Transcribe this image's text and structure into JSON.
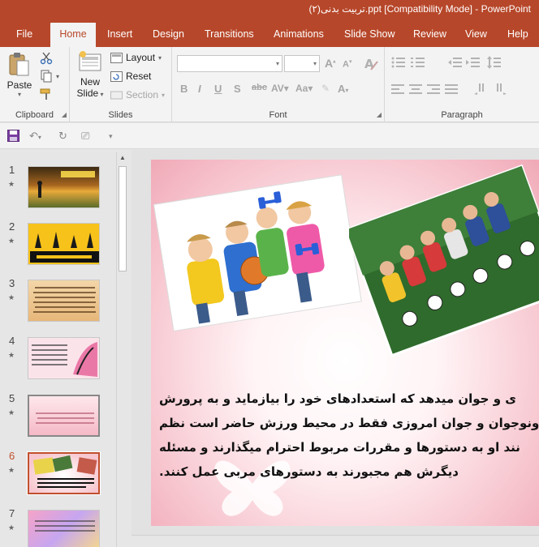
{
  "window": {
    "title": "(۲)تربیت بدنی.ppt [Compatibility Mode]  -  PowerPoint"
  },
  "ribbon_tabs": [
    {
      "label": "File"
    },
    {
      "label": "Home"
    },
    {
      "label": "Insert"
    },
    {
      "label": "Design"
    },
    {
      "label": "Transitions"
    },
    {
      "label": "Animations"
    },
    {
      "label": "Slide Show"
    },
    {
      "label": "Review"
    },
    {
      "label": "View"
    },
    {
      "label": "Help"
    }
  ],
  "ribbon": {
    "clipboard": {
      "label": "Clipboard",
      "paste": "Paste"
    },
    "slides": {
      "label": "Slides",
      "new_slide_line1": "New",
      "new_slide_line2": "Slide",
      "layout": "Layout",
      "reset": "Reset",
      "section": "Section"
    },
    "font": {
      "label": "Font"
    },
    "paragraph": {
      "label": "Paragraph"
    }
  },
  "thumbnails": [
    {
      "num": "1",
      "kind": "sunset"
    },
    {
      "num": "2",
      "kind": "yellow"
    },
    {
      "num": "3",
      "kind": "parchment"
    },
    {
      "num": "4",
      "kind": "pink-text"
    },
    {
      "num": "5",
      "kind": "pink-light"
    },
    {
      "num": "6",
      "kind": "current"
    },
    {
      "num": "7",
      "kind": "colorful"
    }
  ],
  "current_slide": 6,
  "slide": {
    "lines": [
      "ی و جوان میدهد که استعدادهای خود را بیازماید و به پرورش",
      "ونوجوان و جوان امروزی فقط در محیط ورزش حاضر است نظم",
      "نند او به دستورها و مقررات مربوط احترام میگذارند و مسئله",
      "دیگرش هم مجبورند به دستورهای مربی عمل کنند."
    ]
  },
  "colors": {
    "accent": "#b7472a",
    "selected_thumb": "#c0502d"
  }
}
